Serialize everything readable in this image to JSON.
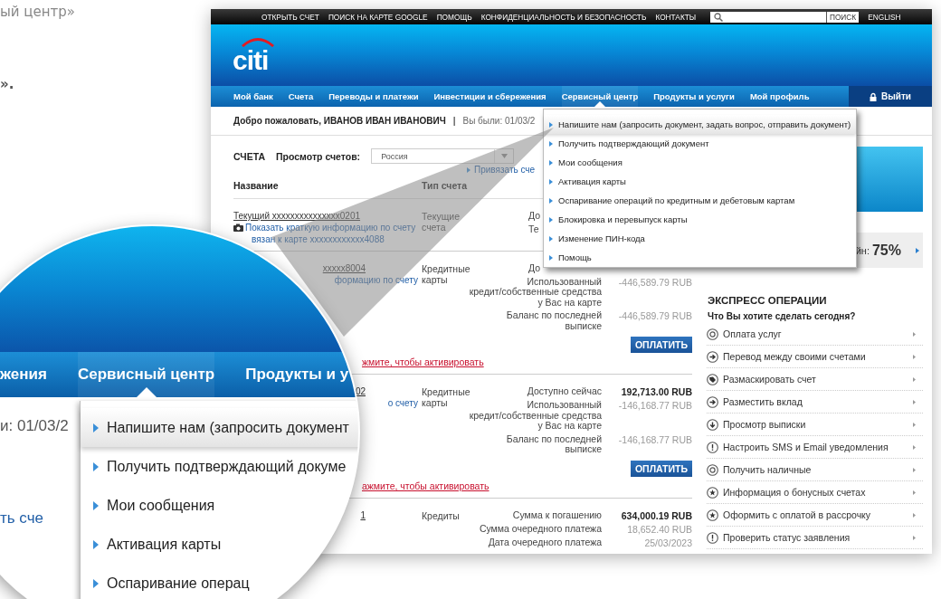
{
  "article": [
    {
      "text": "ый центр»",
      "kind": "plain"
    },
    {
      "text": "».",
      "kind": "bold"
    }
  ],
  "site": {
    "top_links": [
      "ОТКРЫТЬ СЧЕТ",
      "ПОИСК НА КАРТЕ GOOGLE",
      "ПОМОЩЬ",
      "КОНФИДЕНЦИАЛЬНОСТЬ И БЕЗОПАСНОСТЬ",
      "КОНТАКТЫ"
    ],
    "search_button": "ПОИСК",
    "language": "ENGLISH",
    "logo": "citi",
    "nav": [
      {
        "label": "Мой банк",
        "selected": false
      },
      {
        "label": "Счета",
        "selected": false
      },
      {
        "label": "Переводы и платежи",
        "selected": false
      },
      {
        "label": "Инвестиции и сбережения",
        "selected": false
      },
      {
        "label": "Сервисный центр",
        "selected": true
      },
      {
        "label": "Продукты и услуги",
        "selected": false
      },
      {
        "label": "Мой профиль",
        "selected": false
      }
    ],
    "logout": "Выйти",
    "welcome": "Добро пожаловать, ИВАНОВ ИВАН ИВАНОВИЧ",
    "separator": "|",
    "last_visit": "Вы были: 01/03/2",
    "service_menu": [
      {
        "label": "Напишите нам (запросить документ, задать вопрос, отправить документ)",
        "selected": true
      },
      {
        "label": "Получить подтверждающий документ",
        "selected": false
      },
      {
        "label": "Мои сообщения",
        "selected": false
      },
      {
        "label": "Активация карты",
        "selected": false
      },
      {
        "label": "Оспаривание операций по кредитным и дебетовым картам",
        "selected": false
      },
      {
        "label": "Блокировка и перевыпуск карты",
        "selected": false
      },
      {
        "label": "Изменение ПИН-кода",
        "selected": false
      },
      {
        "label": "Помощь",
        "selected": false
      }
    ],
    "accounts": {
      "title": "СЧЕТА",
      "view_label": "Просмотр счетов:",
      "view_value": "Россия",
      "bind_link": "Привязать сче",
      "columns": [
        "Название",
        "Тип счета"
      ],
      "rows": [
        {
          "clipped": false,
          "name": "Текущий xxxxxxxxxxxxxxx0201",
          "info_link": "Показать краткую информацию по счету",
          "card_link": "вязан к карте xxxxxxxxxxxx4088",
          "type": "Текущие\nсчета",
          "details": [
            {
              "label": "До"
            },
            {
              "label": "Те"
            }
          ]
        },
        {
          "clipped": true,
          "name": "xxxxx8004",
          "info_link": "формацию по счету",
          "type": "Кредитные\nкарты",
          "details": [
            {
              "label": "До"
            },
            {
              "label": "Использованный\nкредит/собственные средства\nу Вас на карте",
              "value": "-446,589.79 RUB",
              "emphasis": false
            },
            {
              "label": "Баланс по последней\nвыписке",
              "value": "-446,589.79 RUB",
              "emphasis": false
            }
          ],
          "button": "ОПЛАТИТЬ",
          "activate_link": "жмите, чтобы активировать"
        },
        {
          "clipped": true,
          "name": "02",
          "info_link": "о счету",
          "type": "Кредитные\nкарты",
          "details": [
            {
              "label": "Доступно сейчас",
              "value": "192,713.00 RUB",
              "emphasis": true
            },
            {
              "label": "Использованный\nкредит/собственные средства\nу Вас на карте",
              "value": "-146,168.77 RUB",
              "emphasis": false
            },
            {
              "label": "Баланс по последней\nвыписке",
              "value": "-146,168.77 RUB",
              "emphasis": false
            }
          ],
          "button": "ОПЛАТИТЬ",
          "activate_link": "ажмите, чтобы активировать"
        },
        {
          "clipped": true,
          "name": "1",
          "type": "Кредиты",
          "details": [
            {
              "label": "Сумма к погашению",
              "value": "634,000.19 RUB",
              "emphasis": true
            },
            {
              "label": "Сумма очередного платежа",
              "value": "18,652.40 RUB",
              "emphasis": false
            },
            {
              "label": "Дата очередного платежа",
              "value": "25/03/2023",
              "emphasis": false
            }
          ]
        }
      ]
    },
    "sidebar": {
      "promo_fragment": "йн:",
      "promo_value": "75%",
      "express_title": "ЭКСПРЕСС ОПЕРАЦИИ",
      "express_subtitle": "Что Вы хотите сделать сегодня?",
      "express_items": [
        {
          "label": "Оплата услуг",
          "kind": "coin"
        },
        {
          "label": "Перевод между своими счетами",
          "kind": "arrow"
        },
        {
          "label": "Размаскировать счет",
          "kind": "tag"
        },
        {
          "label": "Разместить вклад",
          "kind": "arrow"
        },
        {
          "label": "Просмотр выписки",
          "kind": "download"
        },
        {
          "label": "Настроить SMS и Email уведомления",
          "kind": "alert"
        },
        {
          "label": "Получить наличные",
          "kind": "coin"
        },
        {
          "label": "Информация о бонусных счетах",
          "kind": "star"
        },
        {
          "label": "Оформить с оплатой в рассрочку",
          "kind": "star"
        },
        {
          "label": "Проверить статус заявления",
          "kind": "alert"
        }
      ]
    }
  },
  "magnifier": {
    "nav": [
      {
        "label": "жения",
        "selected": false
      },
      {
        "label": "Сервисный центр",
        "selected": true
      },
      {
        "label": "Продукты и у",
        "selected": false
      }
    ],
    "last_visit": "и: 01/03/2",
    "bind_link": "ть сче",
    "menu": [
      {
        "label": "Напишите нам (запросить документ",
        "selected": true
      },
      {
        "label": "Получить подтверждающий докуме",
        "selected": false
      },
      {
        "label": "Мои сообщения",
        "selected": false
      },
      {
        "label": "Активация карты",
        "selected": false
      },
      {
        "label": "Оспаривание операц",
        "selected": false
      }
    ]
  }
}
